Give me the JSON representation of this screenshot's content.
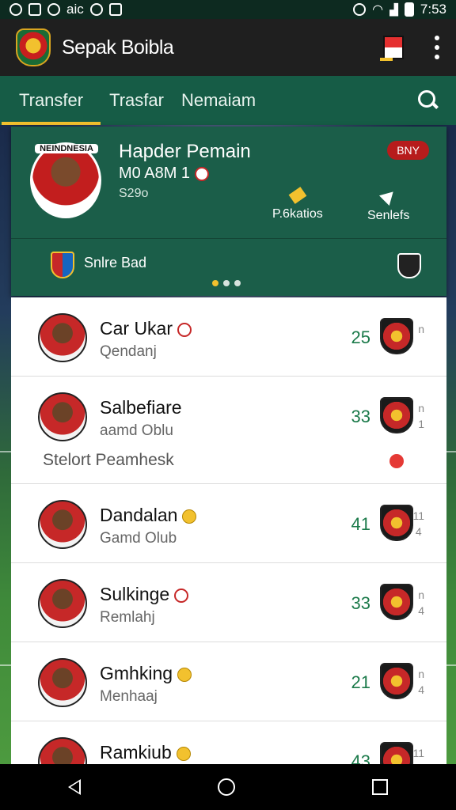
{
  "status_bar": {
    "time": "7:53",
    "left_text": "aic"
  },
  "app_bar": {
    "title": "Sepak Boibla"
  },
  "tabs": [
    {
      "label": "Transfer",
      "active": true
    },
    {
      "label": "Trasfar",
      "active": false
    },
    {
      "label": "Nemaiam",
      "active": false
    }
  ],
  "featured": {
    "avatar_label": "NEINDNESIA",
    "name": "Hapder Pemain",
    "subtitle": "M0 A8M 1",
    "meta": "S29o",
    "badge": "BNY",
    "action1_label": "P.6katios",
    "action2_label": "Senlefs",
    "club_name": "Snlre Bad",
    "carousel": {
      "count": 3,
      "active_index": 0
    }
  },
  "players": [
    {
      "name": "Car Ukar",
      "sub": "Qendanj",
      "score": "25",
      "rank_top": "n",
      "rank_bottom": ""
    },
    {
      "name": "Salbefiare",
      "sub": "aamd Oblu",
      "score": "33",
      "rank_top": "n",
      "rank_bottom": "1",
      "extra_label": "Stelort Peamhesk"
    },
    {
      "name": "Dandalan",
      "sub": "Gamd Olub",
      "score": "41",
      "rank_top": "11",
      "rank_bottom": "4"
    },
    {
      "name": "Sulkinge",
      "sub": "Remlahj",
      "score": "33",
      "rank_top": "n",
      "rank_bottom": "4"
    },
    {
      "name": "Gmhking",
      "sub": "Menhaaj",
      "score": "21",
      "rank_top": "n",
      "rank_bottom": "4"
    },
    {
      "name": "Ramkiub",
      "sub": "",
      "score": "43",
      "rank_top": "11",
      "rank_bottom": ""
    }
  ],
  "colors": {
    "primary": "#165c46",
    "card": "#1b5e49",
    "accent": "#f2c12e",
    "badge_red": "#b71c1c",
    "score_green": "#1b7a4a"
  }
}
